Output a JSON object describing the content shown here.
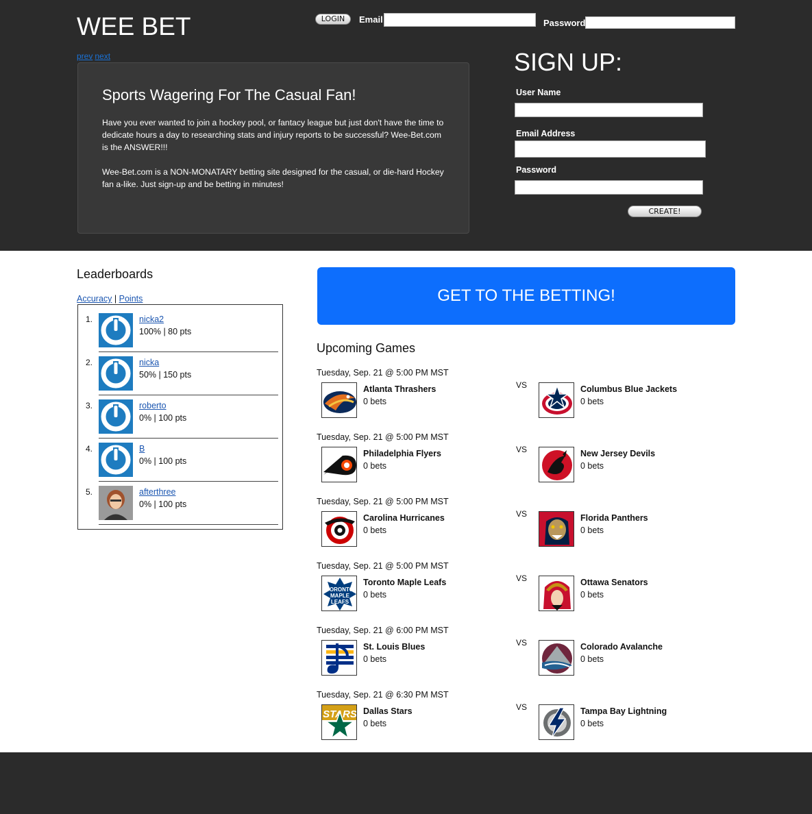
{
  "header": {
    "logo": "WEE BET",
    "login_label": "LOGIN",
    "email_label": "Email",
    "password_label": "Password",
    "pager": {
      "prev": "prev",
      "next": "next"
    }
  },
  "promo": {
    "title": "Sports Wagering For The Casual Fan!",
    "p1": "Have you ever wanted to join a hockey pool, or fantacy league but just don't have the time to dedicate hours a day to researching stats and injury reports to be successful? Wee-Bet.com is the ANSWER!!!",
    "p2": "Wee-Bet.com is a NON-MONATARY betting site designed for the casual, or die-hard Hockey fan a-like. Just sign-up and be betting in minutes!"
  },
  "signup": {
    "title": "SIGN UP:",
    "username_label": "User Name",
    "email_label": "Email Address",
    "password_label": "Password",
    "create_label": "CREATE!"
  },
  "leaderboard": {
    "title": "Leaderboards",
    "tab_accuracy": "Accuracy",
    "tab_sep": "|",
    "tab_points": "Points",
    "rows": [
      {
        "rank": "1.",
        "name": "nicka2",
        "stat": "100% | 80 pts"
      },
      {
        "rank": "2.",
        "name": "nicka",
        "stat": "50% | 150 pts"
      },
      {
        "rank": "3.",
        "name": "roberto",
        "stat": "0% | 100 pts"
      },
      {
        "rank": "4.",
        "name": "B",
        "stat": "0% | 100 pts"
      },
      {
        "rank": "5.",
        "name": "afterthree",
        "stat": "0% | 100 pts"
      }
    ]
  },
  "cta_label": "GET TO THE BETTING!",
  "upcoming": {
    "title": "Upcoming Games",
    "vs_label": "VS",
    "games": [
      {
        "date": "Tuesday, Sep. 21 @ 5:00 PM MST",
        "home": "Atlanta Thrashers",
        "home_bets": "0 bets",
        "away": "Columbus Blue Jackets",
        "away_bets": "0 bets"
      },
      {
        "date": "Tuesday, Sep. 21 @ 5:00 PM MST",
        "home": "Philadelphia Flyers",
        "home_bets": "0 bets",
        "away": "New Jersey Devils",
        "away_bets": "0 bets"
      },
      {
        "date": "Tuesday, Sep. 21 @ 5:00 PM MST",
        "home": "Carolina Hurricanes",
        "home_bets": "0 bets",
        "away": "Florida Panthers",
        "away_bets": "0 bets"
      },
      {
        "date": "Tuesday, Sep. 21 @ 5:00 PM MST",
        "home": "Toronto Maple Leafs",
        "home_bets": "0 bets",
        "away": "Ottawa Senators",
        "away_bets": "0 bets"
      },
      {
        "date": "Tuesday, Sep. 21 @ 6:00 PM MST",
        "home": "St. Louis Blues",
        "home_bets": "0 bets",
        "away": "Colorado Avalanche",
        "away_bets": "0 bets"
      },
      {
        "date": "Tuesday, Sep. 21 @ 6:30 PM MST",
        "home": "Dallas Stars",
        "home_bets": "0 bets",
        "away": "Tampa Bay Lightning",
        "away_bets": "0 bets"
      }
    ]
  },
  "team_logo_text": {
    "leafs": "TORONTO MAPLE LEAFS",
    "stars": "STARS"
  },
  "colors": {
    "header_bg": "#2b2b2b",
    "accent": "#0d6efd",
    "avatar_blue": "#1e7cc0",
    "link": "#1a55b0"
  }
}
